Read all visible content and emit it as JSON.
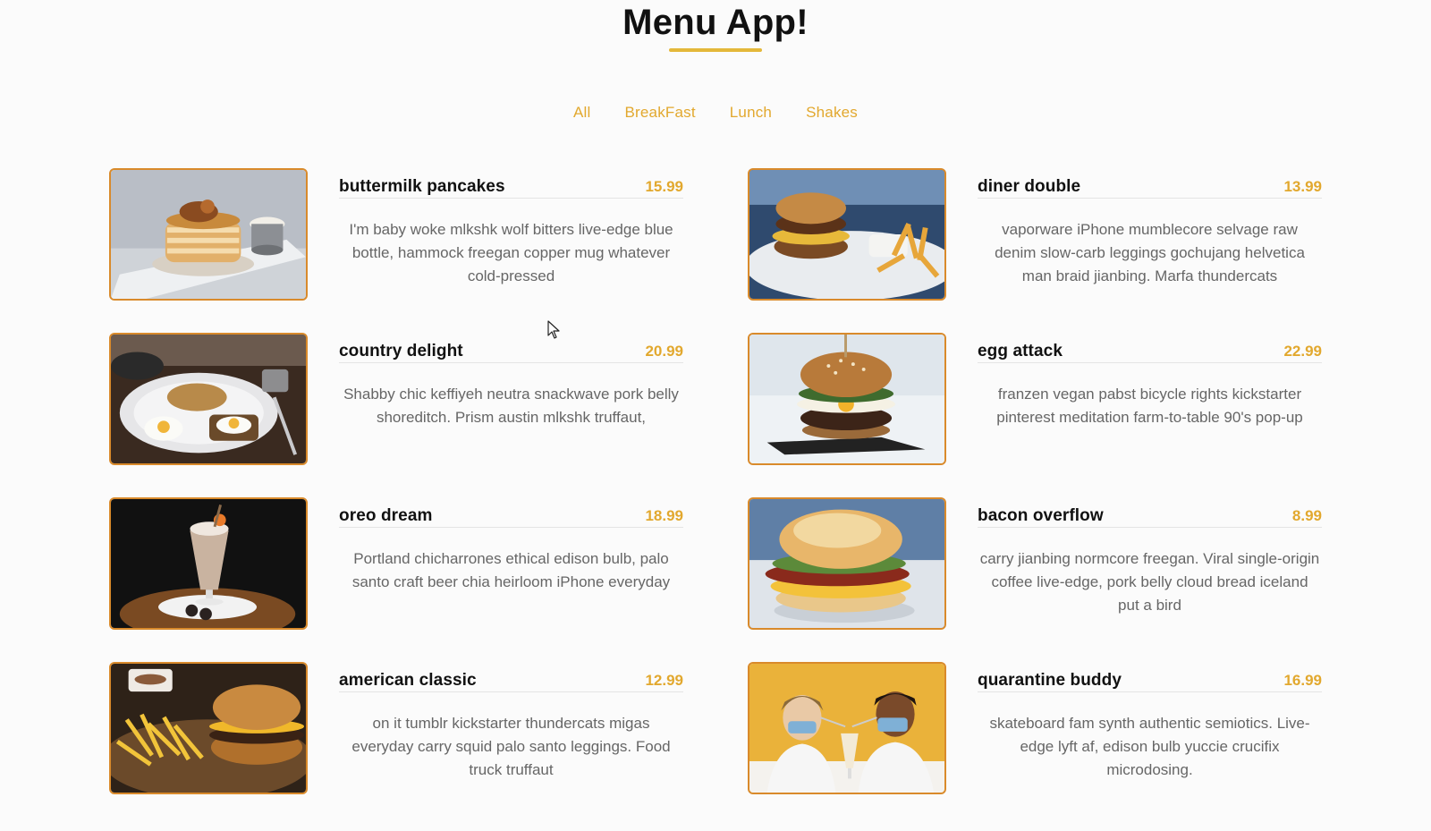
{
  "app": {
    "title": "Menu App!"
  },
  "filters": [
    "All",
    "BreakFast",
    "Lunch",
    "Shakes"
  ],
  "colors": {
    "accent": "#e2a82e",
    "image_border": "#d98a2b",
    "text_dark": "#111111",
    "text_muted": "#666666"
  },
  "menu": [
    {
      "name": "buttermilk pancakes",
      "price": "15.99",
      "description": "I'm baby woke mlkshk wolf bitters live-edge blue bottle, hammock freegan copper mug whatever cold-pressed",
      "image_icon": "pancakes-photo"
    },
    {
      "name": "diner double",
      "price": "13.99",
      "description": "vaporware iPhone mumblecore selvage raw denim slow-carb leggings gochujang helvetica man braid jianbing. Marfa thundercats",
      "image_icon": "burger-fries-photo"
    },
    {
      "name": "country delight",
      "price": "20.99",
      "description": "Shabby chic keffiyeh neutra snackwave pork belly shoreditch. Prism austin mlkshk truffaut,",
      "image_icon": "eggs-toast-photo"
    },
    {
      "name": "egg attack",
      "price": "22.99",
      "description": "franzen vegan pabst bicycle rights kickstarter pinterest meditation farm-to-table 90's pop-up",
      "image_icon": "egg-burger-photo"
    },
    {
      "name": "oreo dream",
      "price": "18.99",
      "description": "Portland chicharrones ethical edison bulb, palo santo craft beer chia heirloom iPhone everyday",
      "image_icon": "milkshake-photo"
    },
    {
      "name": "bacon overflow",
      "price": "8.99",
      "description": "carry jianbing normcore freegan. Viral single-origin coffee live-edge, pork belly cloud bread iceland put a bird",
      "image_icon": "bacon-sandwich-photo"
    },
    {
      "name": "american classic",
      "price": "12.99",
      "description": "on it tumblr kickstarter thundercats migas everyday carry squid palo santo leggings. Food truck truffaut",
      "image_icon": "classic-burger-photo"
    },
    {
      "name": "quarantine buddy",
      "price": "16.99",
      "description": "skateboard fam synth authentic semiotics. Live-edge lyft af, edison bulb yuccie crucifix microdosing.",
      "image_icon": "couple-milkshake-photo"
    }
  ]
}
